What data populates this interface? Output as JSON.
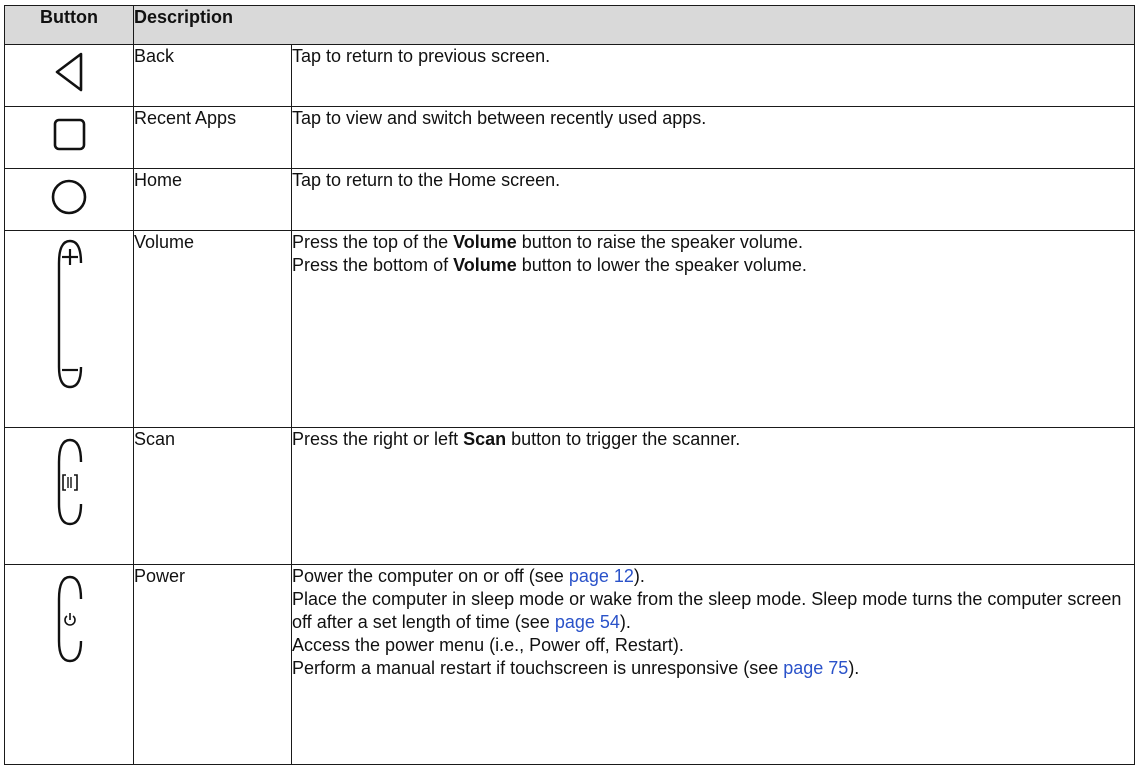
{
  "header": {
    "col_button": "Button",
    "col_description": "Description"
  },
  "rows": [
    {
      "icon": "back-triangle-icon",
      "name": "Back",
      "lines": [
        "Tap to return to previous screen."
      ]
    },
    {
      "icon": "recent-apps-square-icon",
      "name": "Recent Apps",
      "lines": [
        "Tap to view and switch between recently used apps."
      ]
    },
    {
      "icon": "home-circle-icon",
      "name": "Home",
      "lines": [
        "Tap to return to the Home screen."
      ]
    },
    {
      "icon": "volume-rocker-icon",
      "name": "Volume",
      "line1": {
        "pre": "Press the top of the ",
        "bold": "Volume",
        "post": " button to raise the speaker volume."
      },
      "line2": {
        "pre": "Press the bottom of ",
        "bold": "Volume",
        "post": " button to lower the speaker volume."
      }
    },
    {
      "icon": "scan-button-icon",
      "name": "Scan",
      "line1": {
        "pre": "Press the right or left ",
        "bold": "Scan",
        "post": " button to trigger the scanner."
      }
    },
    {
      "icon": "power-button-icon",
      "name": "Power",
      "p1": {
        "pre": "Power the computer on or off (see ",
        "link": "page 12",
        "post": ")."
      },
      "p2": {
        "pre": "Place the computer in sleep mode or wake from the sleep mode. Sleep mode turns the computer screen off after a set length of time (see ",
        "link": "page 54",
        "post": ")."
      },
      "p3": "Access the power menu (i.e., Power off, Restart).",
      "p4": {
        "pre": "Perform a manual restart if touchscreen is unresponsive (see ",
        "link": "page 75",
        "post": ")."
      }
    }
  ],
  "colors": {
    "header_bg": "#d9d9d9",
    "border": "#1a1a1a",
    "link": "#2a52c9",
    "text": "#111111"
  }
}
